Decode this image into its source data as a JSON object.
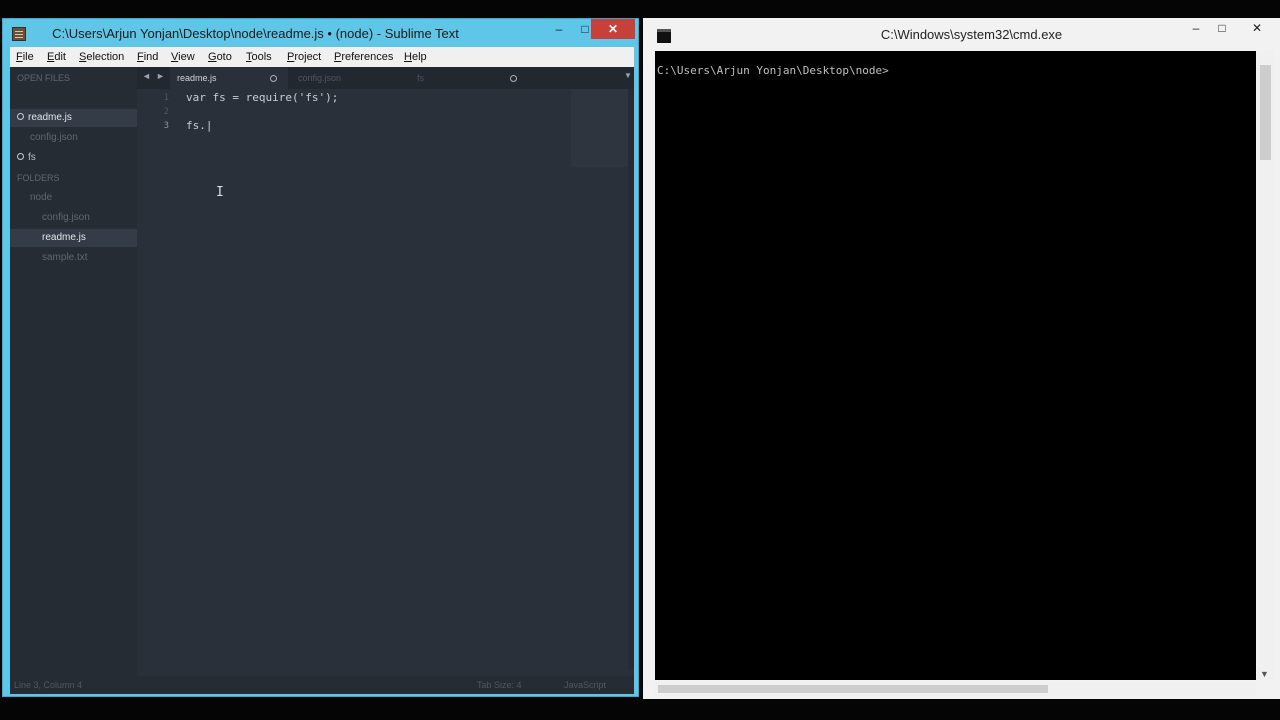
{
  "sublime": {
    "title": "C:\\Users\\Arjun Yonjan\\Desktop\\node\\readme.js • (node) - Sublime Text",
    "controls": {
      "minimize": "–",
      "maximize": "□",
      "close": "✕"
    },
    "menu": [
      "File",
      "Edit",
      "Selection",
      "Find",
      "View",
      "Goto",
      "Tools",
      "Project",
      "Preferences",
      "Help"
    ],
    "sidebar": {
      "open_files_header": "OPEN FILES",
      "open_files": [
        "readme.js",
        "config.json",
        "fs"
      ],
      "folders_header": "FOLDERS",
      "folder": "node",
      "folder_files": [
        "config.json",
        "readme.js",
        "sample.txt"
      ]
    },
    "tabs": [
      "readme.js",
      "config.json",
      "fs"
    ],
    "nav": {
      "back": "◄",
      "forward": "►",
      "dropdown": "▼"
    },
    "line_numbers": [
      "1",
      "2",
      "3"
    ],
    "code_lines": [
      "var fs = require('fs');",
      "",
      "fs.|"
    ],
    "caret_glyph": "I",
    "status": {
      "position": "Line 3, Column 4",
      "tab_size": "Tab Size: 4",
      "syntax": "JavaScript"
    },
    "accent_color": "#60c6e8"
  },
  "cmd": {
    "title": "C:\\Windows\\system32\\cmd.exe",
    "controls": {
      "minimize": "–",
      "maximize": "□",
      "close": "✕"
    },
    "prompt": "C:\\Users\\Arjun Yonjan\\Desktop\\node>",
    "scroll_down_arrow": "▼"
  }
}
